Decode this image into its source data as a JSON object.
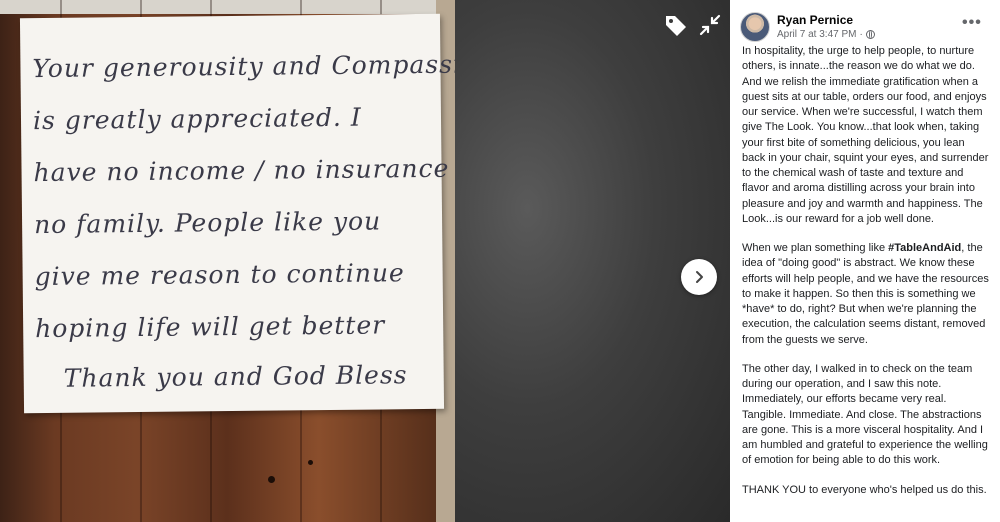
{
  "note": {
    "lines": [
      "Your generousity and Compassion",
      "is greatly appreciated. I",
      "have no income / no insurance",
      "no family. People like you",
      "give me reason to continue",
      "hoping life will get better",
      "Thank you and God Bless"
    ]
  },
  "icons": {
    "tag": "tag-icon",
    "collapse": "collapse-icon",
    "next": "chevron-right-icon",
    "privacy": "globe-icon",
    "more": "more-options-icon"
  },
  "post": {
    "author": "Ryan Pernice",
    "timestamp": "April 7 at 3:47 PM",
    "separator": "·",
    "more_label": "•••",
    "paragraphs": [
      {
        "text": "In hospitality, the urge to help people, to nurture others, is innate...the reason we do what we do. And we relish the immediate gratification when a guest sits at our table, orders our food, and enjoys our service. When we're successful, I watch them give The Look. You know...that look when, taking your first bite of something delicious, you lean back in your chair, squint your eyes, and surrender to the chemical wash of taste and texture and flavor and aroma distilling across your brain into pleasure and joy and warmth and happiness. The Look...is our reward for a job well done."
      },
      {
        "before": "When we plan something like ",
        "hashtag": "#TableAndAid",
        "after": ", the idea of \"doing good\" is abstract. We know these efforts will help people, and we have the resources to make it happen. So then this is something we *have* to do, right? But when we're planning the execution, the calculation seems distant, removed from the guests we serve."
      },
      {
        "text": "The other day, I walked in to check on the team during our operation, and I saw this note. Immediately, our efforts became very real. Tangible. Immediate. And close. The abstractions are gone. This is a more visceral hospitality. And I am humbled and grateful to experience the welling of emotion for being able to do this work."
      },
      {
        "text": "THANK YOU to everyone who's helped us do this."
      }
    ]
  },
  "colors": {
    "panel_bg": "#ffffff",
    "viewer_bg": "#1c1c1c",
    "secondary_text": "#65676b",
    "note_ink": "#3a3a48"
  }
}
